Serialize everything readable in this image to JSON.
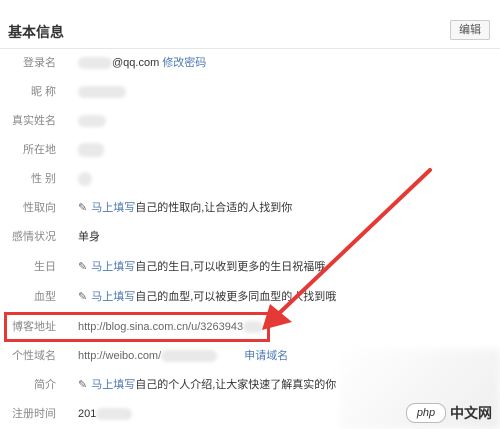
{
  "header": {
    "title": "基本信息",
    "edit_label": "编辑"
  },
  "rows": [
    {
      "label": "登录名",
      "value": "@qq.com",
      "link": "修改密码"
    },
    {
      "label": "昵 称"
    },
    {
      "label": "真实姓名"
    },
    {
      "label": "所在地"
    },
    {
      "label": "性 别"
    },
    {
      "label": "性取向",
      "prompt": "马上填写",
      "text": "自己的性取向,让合适的人找到你"
    },
    {
      "label": "感情状况",
      "value": "单身"
    },
    {
      "label": "生日",
      "prompt": "马上填写",
      "text": "自己的生日,可以收到更多的生日祝福哦"
    },
    {
      "label": "血型",
      "prompt": "马上填写",
      "text": "自己的血型,可以被更多同血型的人找到哦"
    },
    {
      "label": "博客地址",
      "value": "http://blog.sina.com.cn/u/3263943"
    },
    {
      "label": "个性域名",
      "value": "http://weibo.com/",
      "link": "申请域名"
    },
    {
      "label": "简介",
      "prompt": "马上填写",
      "text": "自己的个人介绍,让大家快速了解真实的你"
    },
    {
      "label": "注册时间",
      "value": "201"
    }
  ],
  "watermark": {
    "badge": "php",
    "text": "中文网"
  },
  "colors": {
    "highlight": "#e53935",
    "link": "#4d79b3",
    "label": "#888888"
  }
}
